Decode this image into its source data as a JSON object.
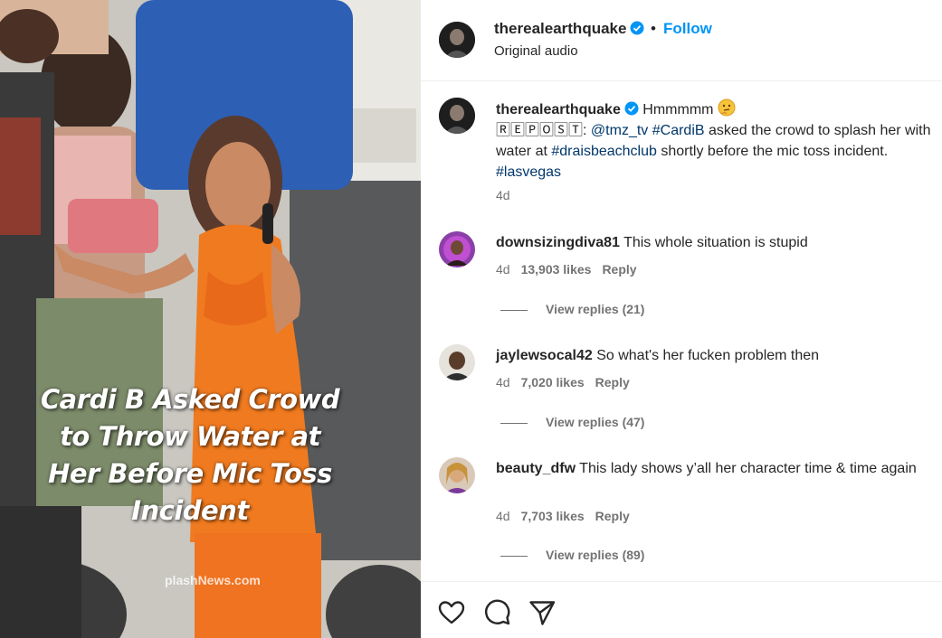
{
  "media": {
    "caption_lines": [
      "Cardi B Asked Crowd",
      "to Throw Water at",
      "Her Before Mic Toss",
      "Incident"
    ],
    "watermark": "plashNews.com"
  },
  "post": {
    "username": "therealearthquake",
    "follow_label": "Follow",
    "separator": "•",
    "audio": "Original audio",
    "verified_color": "#0095f6",
    "link_color": "#00376b"
  },
  "description": {
    "username": "therealearthquake",
    "text_hmm": "Hmmmmm",
    "emoji": "thinking-face-emoji",
    "repost_tag": "🅁🄴🄿🄾🅂🅃",
    "colon": ":",
    "mention": "@tmz_tv",
    "hashtag_cardib": "#CardiB",
    "text_mid": "asked the crowd to splash her with water at",
    "hashtag_drais": "#draisbeachclub",
    "text_end": "shortly before the mic toss incident.",
    "hashtag_lasvegas": "#lasvegas",
    "age": "4d"
  },
  "comments": [
    {
      "username": "downsizingdiva81",
      "text": "This whole situation is stupid",
      "age": "4d",
      "likes": "13,903 likes",
      "reply_label": "Reply",
      "view_replies": "View replies (21)"
    },
    {
      "username": "jaylewsocal42",
      "text": "So what's her fucken problem then",
      "age": "4d",
      "likes": "7,020 likes",
      "reply_label": "Reply",
      "view_replies": "View replies (47)"
    },
    {
      "username": "beauty_dfw",
      "text": "This lady shows y’all her character time & time again",
      "age": "4d",
      "likes": "7,703 likes",
      "reply_label": "Reply",
      "view_replies": "View replies (89)"
    }
  ],
  "actions": {
    "like_icon": "heart-icon",
    "comment_icon": "comment-icon",
    "share_icon": "paper-plane-icon"
  }
}
